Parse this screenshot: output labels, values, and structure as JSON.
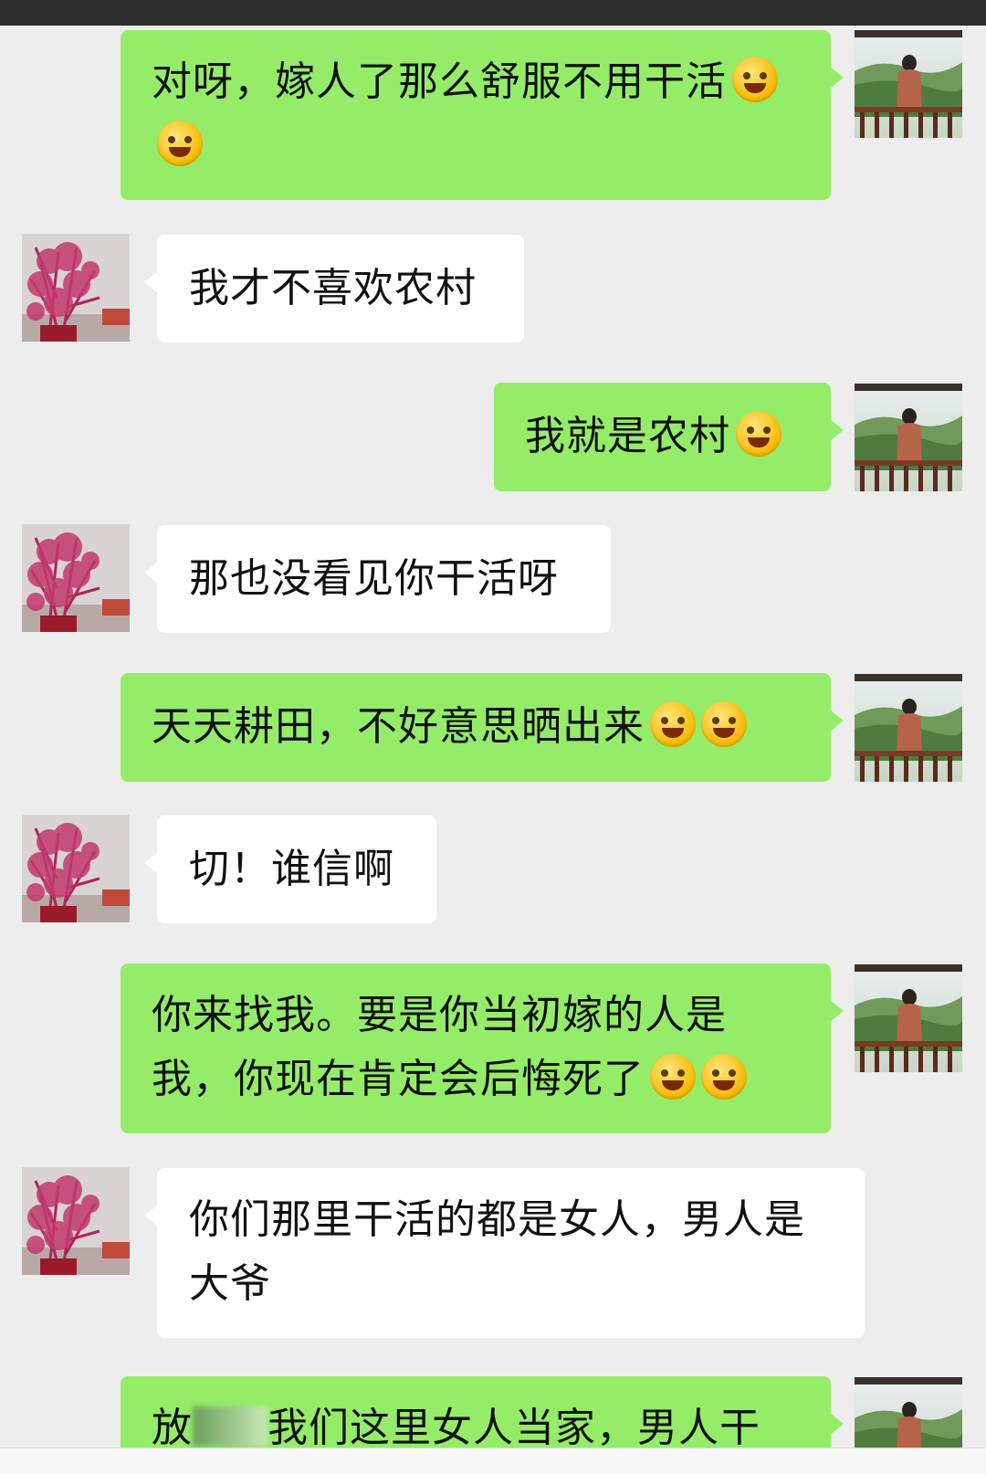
{
  "messages": [
    {
      "side": "me",
      "text": "对呀，嫁人了那么舒服不用干活",
      "emojis": [
        "grin-emoji",
        "grin-emoji"
      ]
    },
    {
      "side": "them",
      "text": "我才不喜欢农村"
    },
    {
      "side": "me",
      "text": "我就是农村",
      "emojis": [
        "smirk-emoji"
      ]
    },
    {
      "side": "them",
      "text": "那也没看见你干活呀"
    },
    {
      "side": "me",
      "text": "天天耕田，不好意思晒出来",
      "emojis": [
        "laugh-cry-emoji",
        "laugh-cry-emoji"
      ]
    },
    {
      "side": "them",
      "text": "切！谁信啊"
    },
    {
      "side": "me",
      "text": "你来找我。要是你当初嫁的人是我，你现在肯定会后悔死了",
      "emojis": [
        "sad-emoji",
        "sad-emoji"
      ]
    },
    {
      "side": "them",
      "text": "你们那里干活的都是女人，男人是大爷"
    },
    {
      "side": "me",
      "text_before": "放",
      "text": "我们这里女人当家，男人干"
    }
  ],
  "avatars": {
    "me": "man-on-balcony-avatar",
    "them": "pink-tree-avatar"
  }
}
